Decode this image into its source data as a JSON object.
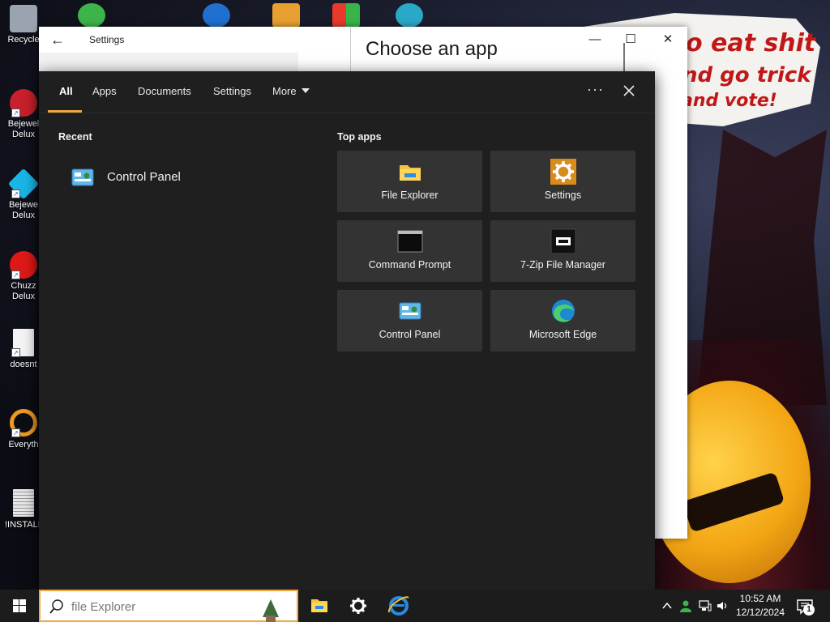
{
  "desktop": {
    "icons": [
      {
        "label": "Recycle",
        "color": "#9aa4b0"
      },
      {
        "label": "Bejewel Delux",
        "color": "#c8202c"
      },
      {
        "label": "Bejewe Delux",
        "color": "#1ab6e8"
      },
      {
        "label": "Chuzz Delux",
        "color": "#e01818"
      },
      {
        "label": "doesnt",
        "color": "#f4f4f4"
      },
      {
        "label": "Everyth",
        "color": "#f09a20"
      },
      {
        "label": "!INSTALL",
        "color": "#e8e8e8"
      }
    ],
    "wallpaper_text": [
      "o eat shit",
      "nd go trick",
      "and vote!"
    ]
  },
  "settings_window": {
    "title": "Settings",
    "back_glyph": "←",
    "minimize_glyph": "—",
    "maximize_glyph": "☐",
    "close_glyph": "✕",
    "panel_title": "Choose an app"
  },
  "search_flyout": {
    "tabs": [
      {
        "label": "All",
        "active": true
      },
      {
        "label": "Apps"
      },
      {
        "label": "Documents"
      },
      {
        "label": "Settings"
      },
      {
        "label": "More"
      }
    ],
    "ellipsis": "···",
    "recent_heading": "Recent",
    "recent_items": [
      {
        "label": "Control Panel",
        "icon": "control-panel-icon"
      }
    ],
    "top_apps_heading": "Top apps",
    "top_apps": [
      {
        "label": "File Explorer",
        "icon": "folder-icon"
      },
      {
        "label": "Settings",
        "icon": "gear-icon"
      },
      {
        "label": "Command Prompt",
        "icon": "terminal-icon"
      },
      {
        "label": "7-Zip File Manager",
        "icon": "archive-icon"
      },
      {
        "label": "Control Panel",
        "icon": "control-panel-icon"
      },
      {
        "label": "Microsoft Edge",
        "icon": "edge-icon"
      }
    ],
    "accent_color": "#f0a840"
  },
  "taskbar": {
    "search": {
      "value": "",
      "placeholder": "file Explorer"
    },
    "apps": [
      {
        "name": "file-explorer",
        "icon": "folder-icon"
      },
      {
        "name": "settings",
        "icon": "gear-icon"
      },
      {
        "name": "internet-explorer",
        "icon": "ie-icon"
      }
    ],
    "clock": {
      "time": "10:52 AM",
      "date": "12/12/2024"
    },
    "notification_count": "1"
  }
}
